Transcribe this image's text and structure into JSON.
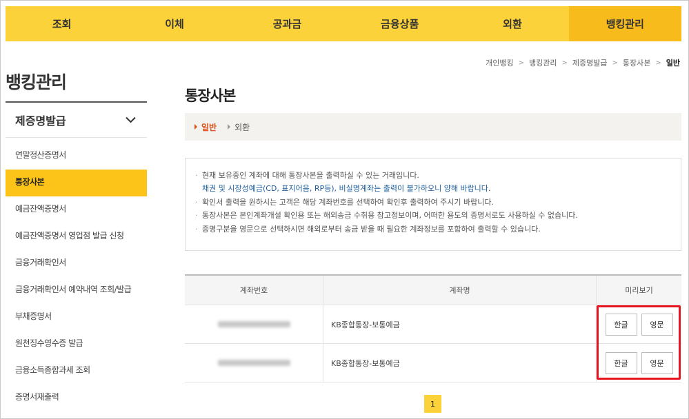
{
  "topnav": [
    "조회",
    "이체",
    "공과금",
    "금융상품",
    "외환",
    "뱅킹관리"
  ],
  "sidebar": {
    "title": "뱅킹관리",
    "group": "제증명발급",
    "items": [
      "연말정산증명서",
      "통장사본",
      "예금잔액증명서",
      "예금잔액증명서 영업점 발급 신청",
      "금융거래확인서",
      "금융거래확인서 예약내역 조회/발급",
      "부채증명서",
      "원천징수영수증 발급",
      "금융소득종합과세 조회",
      "증명서재출력"
    ]
  },
  "breadcrumb": [
    "개인뱅킹",
    "뱅킹관리",
    "제증명발급",
    "통장사본",
    "일반"
  ],
  "page_title": "통장사본",
  "subtabs": [
    "일반",
    "외환"
  ],
  "notice": {
    "l1": "현재 보유중인 계좌에 대해 통장사본을 출력하실 수 있는 거래입니다.",
    "l1b": "채권 및 시장성예금(CD, 표지어음, RP등), 비실명계좌는 출력이 불가하오니 양해 바랍니다.",
    "l2": "확인서 출력을 원하시는 고객은 해당 계좌번호를 선택하여 확인후 출력하여 주시기 바랍니다.",
    "l3": "통장사본은 본인계좌개설 확인용 또는 해외송금 수취용 참고정보이며, 어떠한 용도의 증명서로도 사용하실 수 없습니다.",
    "l4": "증명구분을 영문으로 선택하시면 해외로부터 송금 받을 때 필요한 계좌정보를 포함하여 출력할 수 있습니다."
  },
  "table": {
    "headers": [
      "계좌번호",
      "계좌명",
      "미리보기"
    ],
    "rows": [
      {
        "name": "KB종합통장-보통예금"
      },
      {
        "name": "KB종합통장-보통예금"
      }
    ],
    "btn_ko": "한글",
    "btn_en": "영문"
  },
  "pager": "1",
  "colors": {
    "accent": "#fcd23a",
    "active_tab": "#f7bb1c",
    "highlight": "#e8141f",
    "subtab_active": "#d9531e"
  }
}
